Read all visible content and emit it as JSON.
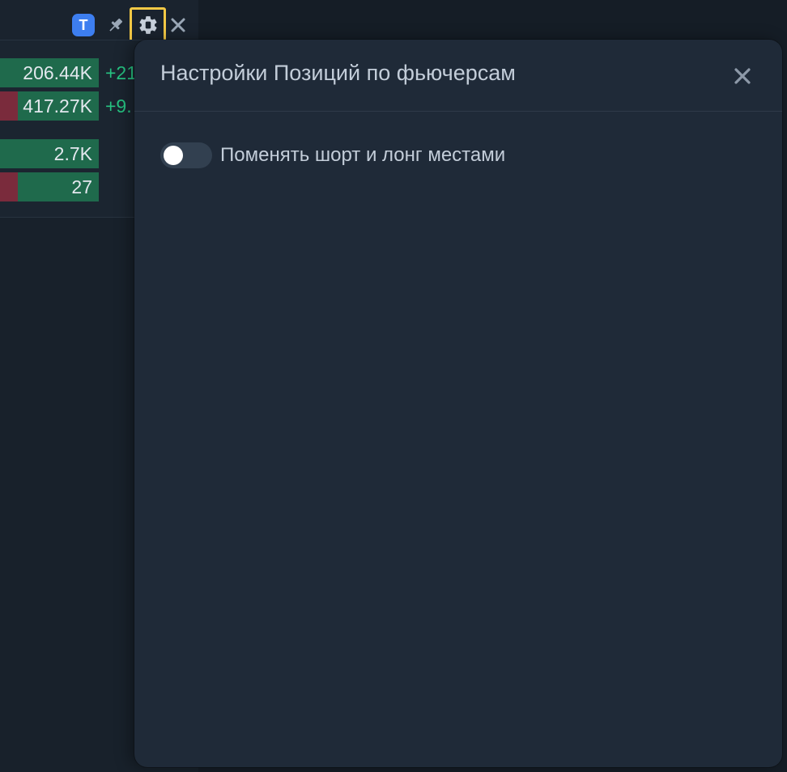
{
  "widget": {
    "header_badge": "T",
    "icons": [
      "pin-icon",
      "gear-icon",
      "close-icon"
    ],
    "rows": [
      {
        "value": "206.44K",
        "delta": "+21",
        "has_red": false
      },
      {
        "value": "417.27K",
        "delta": "+9.",
        "has_red": true
      },
      {
        "value": "2.7K",
        "delta": "",
        "has_red": false
      },
      {
        "value": "27",
        "delta": "",
        "has_red": true
      }
    ]
  },
  "modal": {
    "title": "Настройки Позиций по фьючерсам",
    "close_icon": "close-icon",
    "settings": [
      {
        "label": "Поменять шорт и лонг местами",
        "enabled": false
      }
    ]
  },
  "colors": {
    "accent_blue": "#3d7ef0",
    "highlight_yellow": "#f3c845",
    "positive_green": "#26c281",
    "bar_green": "#1f6a4c",
    "bar_red": "#7a2b3c",
    "modal_bg": "#1f2a38"
  }
}
